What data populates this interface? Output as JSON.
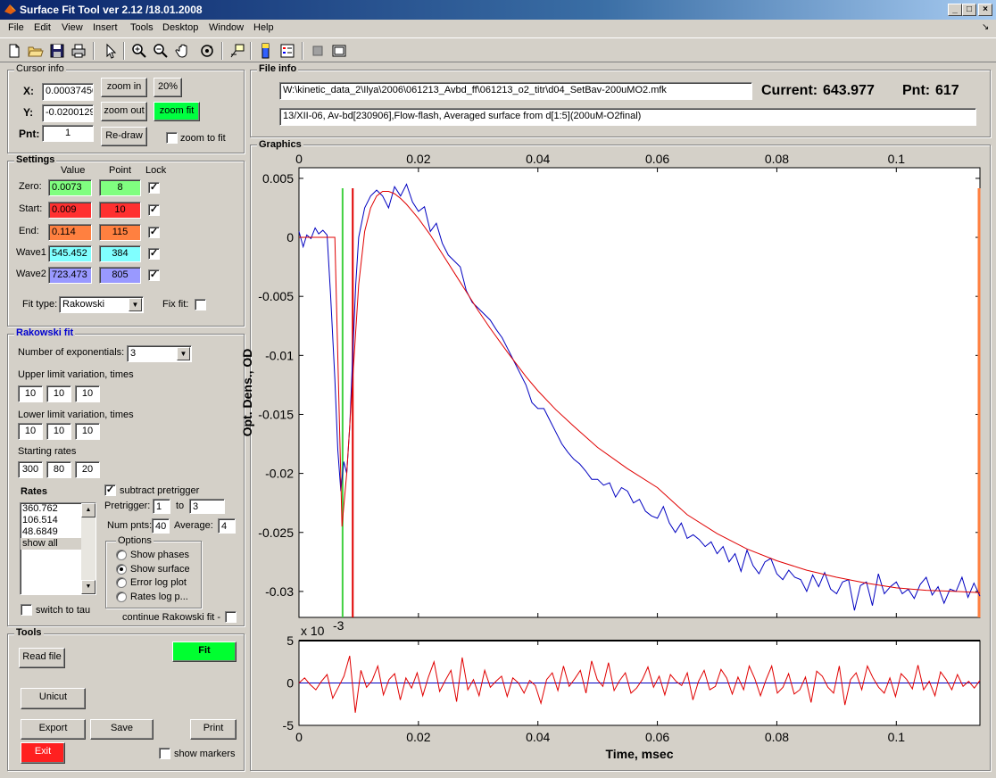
{
  "window": {
    "title": "Surface Fit Tool ver 2.12 /18.01.2008",
    "min_icon": "minimize-icon",
    "max_icon": "maximize-icon",
    "close_icon": "close-icon"
  },
  "menu": [
    "File",
    "Edit",
    "View",
    "Insert",
    "Tools",
    "Desktop",
    "Window",
    "Help"
  ],
  "toolbar_icons": [
    "new-file-icon",
    "open-folder-icon",
    "save-icon",
    "print-icon",
    "pointer-icon",
    "zoom-in-icon",
    "zoom-out-icon",
    "pan-hand-icon",
    "rotate-icon",
    "data-cursor-icon",
    "colorbar-icon",
    "legend-icon",
    "plot-tools-hide-icon",
    "plot-tools-show-icon"
  ],
  "cursor_info": {
    "title": "Cursor info",
    "x_label": "X:",
    "x_value": "0.00037450",
    "y_label": "Y:",
    "y_value": "-0.0200129",
    "pnt_label": "Pnt:",
    "pnt_value": "1",
    "zoom_in": "zoom in",
    "zoom_out": "zoom out",
    "redraw": "Re-draw",
    "pct": "20%",
    "zoom_fit": "zoom fit",
    "zoom_to_fit": "zoom to fit"
  },
  "settings": {
    "title": "Settings",
    "col_value": "Value",
    "col_point": "Point",
    "col_lock": "Lock",
    "rows": [
      {
        "label": "Zero:",
        "value": "0.0073",
        "point": "8",
        "color": "#80ff80"
      },
      {
        "label": "Start:",
        "value": "0.009",
        "point": "10",
        "color": "#ff3030"
      },
      {
        "label": "End:",
        "value": "0.114",
        "point": "115",
        "color": "#ff8040"
      },
      {
        "label": "Wave1",
        "value": "545.452",
        "point": "384",
        "color": "#80ffff"
      },
      {
        "label": "Wave2",
        "value": "723.473",
        "point": "805",
        "color": "#9999ff"
      }
    ],
    "fit_type_label": "Fit type:",
    "fit_type_value": "Rakowski",
    "fix_fit_label": "Fix fit:"
  },
  "rakowski": {
    "title": "Rakowski fit",
    "num_exp_label": "Number of exponentials:",
    "num_exp_value": "3",
    "upper_label": "Upper limit variation, times",
    "upper": [
      "10",
      "10",
      "10"
    ],
    "lower_label": "Lower limit variation, times",
    "lower": [
      "10",
      "10",
      "10"
    ],
    "start_label": "Starting rates",
    "start": [
      "300",
      "80",
      "20"
    ],
    "rates_label": "Rates",
    "rates": [
      "360.762",
      "106.514",
      "48.6849",
      "show all"
    ],
    "subtract_label": "subtract pretrigger",
    "pretrigger_label": "Pretrigger:",
    "pretrigger_from": "1",
    "to_label": "to",
    "pretrigger_to": "3",
    "numpnts_label": "Num pnts:",
    "numpnts": "40",
    "average_label": "Average:",
    "average": "4",
    "options_title": "Options",
    "options": [
      "Show phases",
      "Show surface",
      "Error log plot",
      "Rates log p..."
    ],
    "switch_tau": "switch to tau",
    "continue_label": "continue Rakowski fit -"
  },
  "tools": {
    "title": "Tools",
    "read_file": "Read file",
    "fit": "Fit",
    "unicut": "Unicut",
    "export": "Export",
    "save": "Save",
    "print": "Print",
    "exit": "Exit",
    "show_markers": "show markers"
  },
  "file_info": {
    "title": "File info",
    "path": "W:\\kinetic_data_2\\Ilya\\2006\\061213_Avbd_ff\\061213_o2_titr\\d04_SetBav-200uMO2.mfk",
    "description": "13/XII-06, Av-bd[230906],Flow-flash, Averaged surface from d[1:5](200uM-O2final)",
    "current_label": "Current:",
    "current_value": "643.977",
    "pnt_label": "Pnt:",
    "pnt_value": "617"
  },
  "graphics": {
    "title": "Graphics",
    "colors": {
      "data": "#0000c0",
      "fit": "#e00000",
      "zero_marker": "#40d040",
      "start_marker": "#e00000",
      "end_marker": "#ff8040"
    }
  },
  "chart_data": [
    {
      "type": "line",
      "title": "",
      "xlabel": "",
      "ylabel": "Opt. Dens., OD",
      "xlim": [
        0,
        0.114
      ],
      "ylim": [
        -0.0322,
        0.0059
      ],
      "xticks": [
        "0",
        "0.02",
        "0.04",
        "0.06",
        "0.08",
        "0.1"
      ],
      "xtick_values": [
        0,
        0.02,
        0.04,
        0.06,
        0.08,
        0.1
      ],
      "yticks": [
        "0.005",
        "0",
        "-0.005",
        "-0.01",
        "-0.015",
        "-0.02",
        "-0.025",
        "-0.03"
      ],
      "ytick_values": [
        0.005,
        0,
        -0.005,
        -0.01,
        -0.015,
        -0.02,
        -0.025,
        -0.03
      ],
      "markers_x": {
        "zero": 0.0073,
        "start": 0.009,
        "end": 0.114
      },
      "series": [
        {
          "name": "data",
          "x": [
            0,
            0.0007,
            0.0013,
            0.002,
            0.0027,
            0.0033,
            0.004,
            0.0047,
            0.0053,
            0.006,
            0.0065,
            0.007,
            0.0072,
            0.0075,
            0.008,
            0.0085,
            0.009,
            0.0095,
            0.01,
            0.011,
            0.012,
            0.013,
            0.014,
            0.015,
            0.016,
            0.017,
            0.018,
            0.019,
            0.02,
            0.021,
            0.022,
            0.023,
            0.024,
            0.025,
            0.026,
            0.027,
            0.028,
            0.029,
            0.03,
            0.031,
            0.032,
            0.033,
            0.034,
            0.035,
            0.036,
            0.037,
            0.038,
            0.039,
            0.04,
            0.041,
            0.042,
            0.043,
            0.044,
            0.045,
            0.046,
            0.047,
            0.048,
            0.049,
            0.05,
            0.051,
            0.052,
            0.053,
            0.054,
            0.055,
            0.056,
            0.057,
            0.058,
            0.059,
            0.06,
            0.061,
            0.062,
            0.063,
            0.064,
            0.065,
            0.066,
            0.067,
            0.068,
            0.069,
            0.07,
            0.071,
            0.072,
            0.073,
            0.074,
            0.075,
            0.076,
            0.077,
            0.078,
            0.079,
            0.08,
            0.081,
            0.082,
            0.083,
            0.084,
            0.085,
            0.086,
            0.087,
            0.088,
            0.089,
            0.09,
            0.091,
            0.092,
            0.093,
            0.094,
            0.095,
            0.096,
            0.097,
            0.098,
            0.099,
            0.1,
            0.101,
            0.102,
            0.103,
            0.104,
            0.105,
            0.106,
            0.107,
            0.108,
            0.109,
            0.11,
            0.111,
            0.112,
            0.113,
            0.114
          ],
          "values": [
            0.0005,
            -0.0008,
            0.0002,
            -0.0001,
            0.0008,
            0.0003,
            0.0006,
            0.0002,
            -0.005,
            -0.012,
            -0.018,
            -0.0215,
            -0.0205,
            -0.019,
            -0.02,
            -0.016,
            -0.01,
            -0.004,
            0.0,
            0.0025,
            0.0035,
            0.004,
            0.0035,
            0.0025,
            0.0043,
            0.0035,
            0.0045,
            0.003,
            0.0022,
            0.0026,
            0.0005,
            0.0012,
            -0.0005,
            -0.0015,
            -0.002,
            -0.0025,
            -0.0045,
            -0.0055,
            -0.006,
            -0.0065,
            -0.007,
            -0.0078,
            -0.0085,
            -0.0095,
            -0.0105,
            -0.0115,
            -0.0125,
            -0.014,
            -0.0145,
            -0.0145,
            -0.0155,
            -0.0165,
            -0.0175,
            -0.0182,
            -0.0188,
            -0.0192,
            -0.0198,
            -0.0205,
            -0.0205,
            -0.021,
            -0.0208,
            -0.022,
            -0.0212,
            -0.0215,
            -0.0225,
            -0.0222,
            -0.0232,
            -0.0236,
            -0.0238,
            -0.0228,
            -0.0242,
            -0.025,
            -0.0242,
            -0.0255,
            -0.0252,
            -0.0256,
            -0.0262,
            -0.0258,
            -0.0268,
            -0.0262,
            -0.0275,
            -0.0268,
            -0.0283,
            -0.0265,
            -0.0278,
            -0.0285,
            -0.0275,
            -0.0272,
            -0.0285,
            -0.029,
            -0.0282,
            -0.0288,
            -0.029,
            -0.03,
            -0.0286,
            -0.0296,
            -0.0284,
            -0.0298,
            -0.0302,
            -0.0292,
            -0.029,
            -0.0316,
            -0.0295,
            -0.0292,
            -0.0312,
            -0.0285,
            -0.0302,
            -0.0296,
            -0.0292,
            -0.0302,
            -0.0298,
            -0.0306,
            -0.0294,
            -0.0288,
            -0.0303,
            -0.0296,
            -0.031,
            -0.0298,
            -0.03,
            -0.0288,
            -0.0305,
            -0.0293,
            -0.0304
          ]
        },
        {
          "name": "fit",
          "x": [
            0,
            0.006,
            0.0072,
            0.008,
            0.009,
            0.01,
            0.011,
            0.012,
            0.013,
            0.014,
            0.015,
            0.016,
            0.017,
            0.018,
            0.019,
            0.02,
            0.022,
            0.024,
            0.026,
            0.028,
            0.03,
            0.032,
            0.035,
            0.038,
            0.04,
            0.043,
            0.046,
            0.05,
            0.055,
            0.06,
            0.065,
            0.07,
            0.075,
            0.08,
            0.085,
            0.09,
            0.095,
            0.1,
            0.105,
            0.11,
            0.114
          ],
          "values": [
            0.0,
            0.0,
            -0.0245,
            -0.02,
            -0.012,
            -0.004,
            0.0005,
            0.0025,
            0.0035,
            0.0039,
            0.0039,
            0.0037,
            0.0033,
            0.0028,
            0.0022,
            0.0016,
            0.0002,
            -0.0014,
            -0.003,
            -0.0046,
            -0.0062,
            -0.0077,
            -0.0098,
            -0.0118,
            -0.013,
            -0.0146,
            -0.016,
            -0.0178,
            -0.0196,
            -0.0212,
            -0.0235,
            -0.0251,
            -0.0264,
            -0.0274,
            -0.0282,
            -0.0288,
            -0.0293,
            -0.0297,
            -0.0299,
            -0.03,
            -0.0301
          ]
        }
      ]
    },
    {
      "type": "line",
      "title": "",
      "xlabel": "Time, msec",
      "ylabel": "",
      "exponent_label": "x 10",
      "exponent_power": "-3",
      "xlim": [
        0,
        0.114
      ],
      "ylim": [
        -5,
        5
      ],
      "xticks": [
        "0",
        "0.02",
        "0.04",
        "0.06",
        "0.08",
        "0.1"
      ],
      "xtick_values": [
        0,
        0.02,
        0.04,
        0.06,
        0.08,
        0.1
      ],
      "yticks": [
        "5",
        "0",
        "-5"
      ],
      "ytick_values": [
        5,
        0,
        -5
      ],
      "series": [
        {
          "name": "residuals",
          "values": [
            0,
            0.6,
            -0.2,
            -0.8,
            0.2,
            1.0,
            -1.8,
            -0.5,
            0.8,
            3.2,
            -3.5,
            1.5,
            -0.5,
            0.3,
            2.0,
            -1.4,
            0.4,
            1.1,
            -2.0,
            0.6,
            -0.6,
            1.2,
            -1.5,
            0.7,
            2.5,
            -1.0,
            0.3,
            1.5,
            -2.2,
            3.0,
            -0.8,
            0.4,
            -1.5,
            1.5,
            -0.5,
            0.2,
            0.8,
            -1.6,
            0.6,
            0.0,
            -1.2,
            0.3,
            -0.3,
            -2.4,
            0.4,
            1.2,
            -0.9,
            2.0,
            -0.4,
            0.5,
            1.5,
            -1.2,
            2.6,
            0.4,
            -0.4,
            2.4,
            -0.9,
            0.3,
            1.2,
            -1.2,
            -0.6,
            0.4,
            1.9,
            -0.5,
            0.8,
            -1.4,
            1.0,
            0.2,
            -0.3,
            1.2,
            -2.0,
            0.2,
            1.5,
            -0.8,
            -0.4,
            1.6,
            0.6,
            -1.3,
            0.7,
            -0.8,
            2.0,
            0.5,
            -1.5,
            0.4,
            2.0,
            -1.2,
            -0.5,
            1.1,
            -1.3,
            -0.8,
            0.7,
            -2.3,
            1.4,
            0.8,
            -0.5,
            -1.2,
            2.0,
            -2.6,
            0.4,
            1.2,
            -0.8,
            2.0,
            0.6,
            -0.5,
            -1.2,
            0.6,
            -1.6,
            1.1,
            0.4,
            -0.7,
            2.1,
            -0.8,
            0.2,
            -1.5,
            1.3,
            0.4,
            -0.8,
            1.0,
            -0.4,
            0.2,
            -0.6,
            0.3
          ]
        },
        {
          "name": "zero-line",
          "values": [
            0,
            0
          ]
        }
      ]
    }
  ]
}
